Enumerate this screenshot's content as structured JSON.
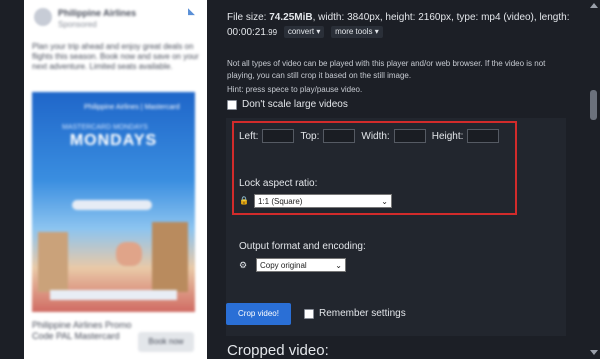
{
  "ad": {
    "brand": "Philippine Airlines",
    "sponsored": "Sponsored",
    "text": "Plan your trip ahead and enjoy great deals on flights this season. Book now and save on your next adventure. Limited seats available.",
    "image_brand": "Philippine Airlines | Mastercard",
    "image_sub": "MASTERCARD MONDAYS",
    "image_title": "MONDAYS",
    "footer_text": "Philippine Airlines Promo Code PAL Mastercard",
    "footer_button": "Book now"
  },
  "fileinfo": {
    "size_label": "File size:",
    "size_value": "74.25MiB",
    "width_label": ", width:",
    "width_value": "3840px",
    "height_label": ", height:",
    "height_value": "2160px",
    "type_label": ", type:",
    "type_value": "mp4 (video)",
    "length_label": ", length:",
    "length_value": "00:00:21",
    "length_ms": ".99",
    "convert_label": "convert",
    "more_tools_label": "more tools"
  },
  "note": "Not all types of video can be played with this player and/or web browser. If the video is not playing, you can still crop it based on the still image.",
  "hint": "Hint: press spece to play/pause video.",
  "dont_scale_label": "Don't scale large videos",
  "crop": {
    "left_label": "Left:",
    "top_label": "Top:",
    "width_label": "Width:",
    "height_label": "Height:",
    "left_value": "",
    "top_value": "",
    "width_value": "",
    "height_value": "",
    "lock_label": "Lock aspect ratio:",
    "aspect_selected": "1:1 (Square)"
  },
  "output": {
    "label": "Output format and encoding:",
    "selected": "Copy original"
  },
  "crop_button": "Crop video!",
  "remember_label": "Remember settings",
  "cropped_title": "Cropped video:",
  "colors": {
    "background": "#1c1f26",
    "panel": "#22262e",
    "accent_button": "#2a6fd6",
    "highlight": "#d22b2b",
    "lock": "#e2a33a"
  },
  "icons": [
    "lock-icon",
    "gear-icon",
    "chevron-down-icon"
  ]
}
